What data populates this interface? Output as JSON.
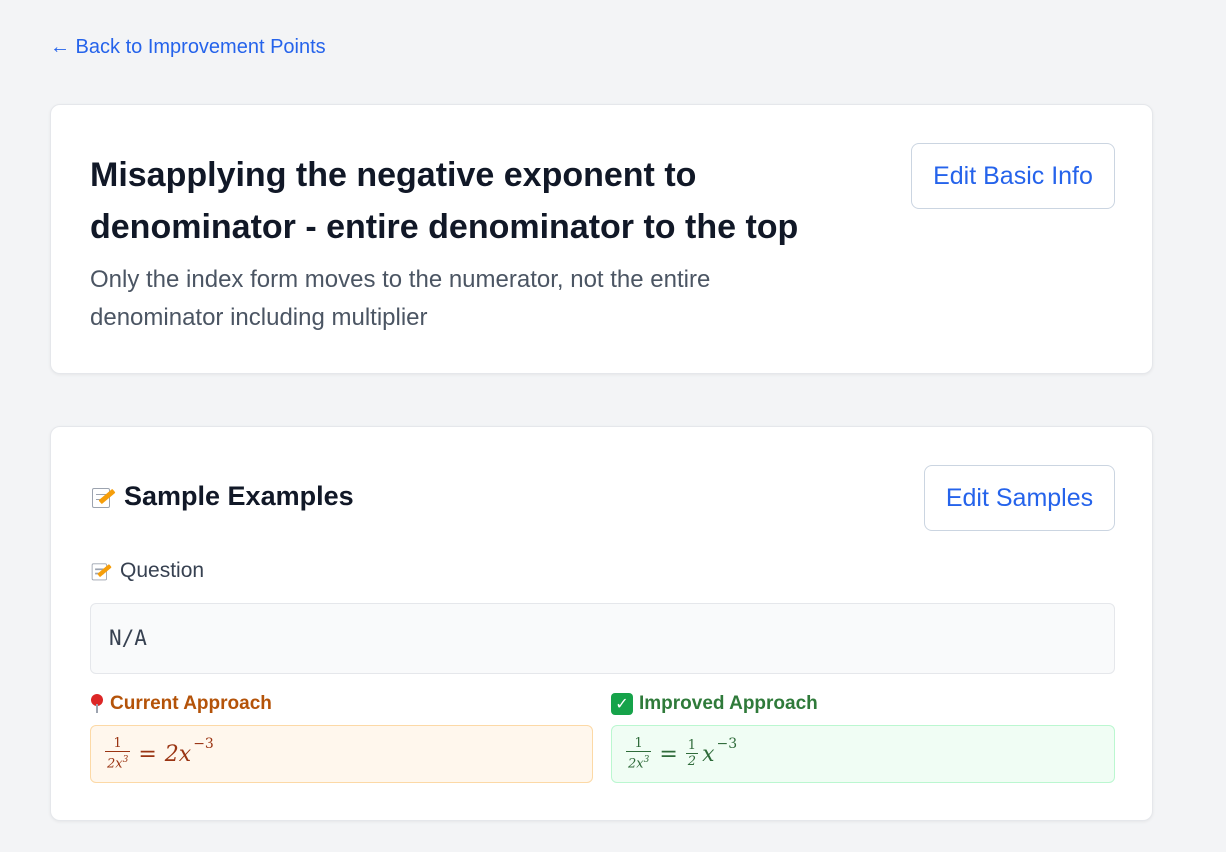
{
  "nav": {
    "back_label": "← Back to Improvement Points"
  },
  "basic_info": {
    "title": "Misapplying the negative exponent to denominator - entire denominator to the top",
    "description": "Only the index form moves to the numerator, not the entire denominator including multiplier",
    "edit_label": "Edit Basic Info"
  },
  "samples": {
    "section_title": "Sample Examples",
    "edit_label": "Edit Samples",
    "question_label": "Question",
    "question_value": "N/A",
    "current_label": "Current Approach",
    "improved_label": "Improved Approach",
    "current_math": {
      "lhs_num": "1",
      "lhs_den": "2x",
      "lhs_den_exp": "3",
      "eq": "=",
      "rhs": "2x",
      "rhs_exp": "−3"
    },
    "improved_math": {
      "lhs_num": "1",
      "lhs_den": "2x",
      "lhs_den_exp": "3",
      "eq": "=",
      "coef_num": "1",
      "coef_den": "2",
      "rhs": "x",
      "rhs_exp": "−3"
    }
  },
  "icons": {
    "back": "arrow-left-icon",
    "memo": "memo-icon",
    "pin": "pin-icon",
    "check": "check-mark-icon"
  },
  "colors": {
    "link": "#2563eb",
    "current": "#b45309",
    "improved": "#2f7a3a",
    "background": "#f3f4f6"
  }
}
